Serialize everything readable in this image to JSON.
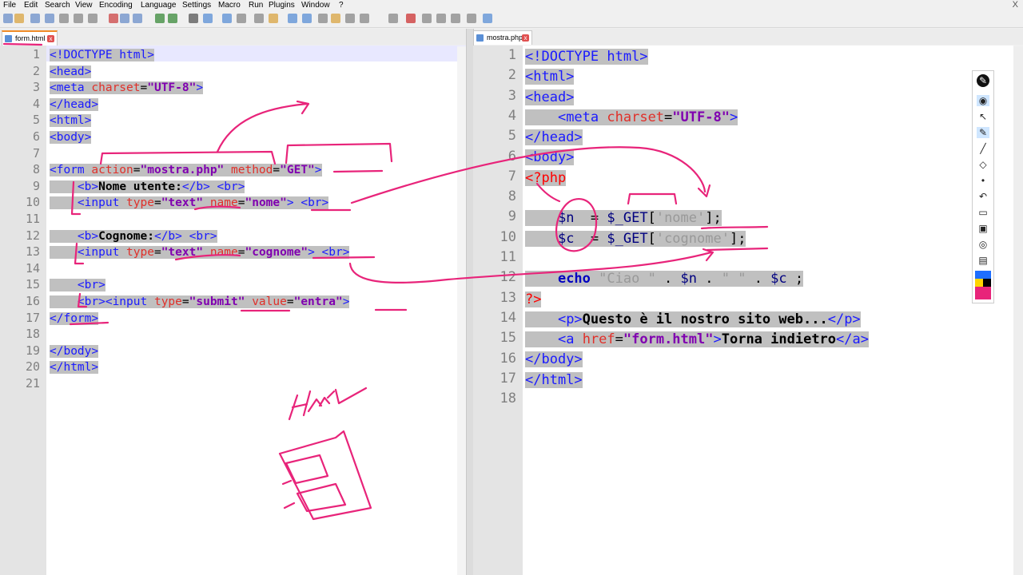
{
  "menu": {
    "items": [
      "File",
      "Edit",
      "Search",
      "View",
      "Encoding",
      "Language",
      "Settings",
      "Macro",
      "Run",
      "Plugins",
      "Window",
      "?"
    ],
    "close": "X"
  },
  "tabs": {
    "left": {
      "label": "form.html",
      "close": "x"
    },
    "right": {
      "label": "mostra.php",
      "close": "x"
    }
  },
  "left": {
    "line_numbers": [
      "1",
      "2",
      "3",
      "4",
      "5",
      "6",
      "7",
      "8",
      "9",
      "10",
      "11",
      "12",
      "13",
      "14",
      "15",
      "16",
      "17",
      "18",
      "19",
      "20",
      "21"
    ]
  },
  "right": {
    "line_numbers": [
      "1",
      "2",
      "3",
      "4",
      "5",
      "6",
      "7",
      "8",
      "9",
      "10",
      "11",
      "12",
      "13",
      "14",
      "15",
      "16",
      "17",
      "18"
    ]
  },
  "colors": {
    "accent_pen": "#e8247a",
    "selection": "#c0c0c0"
  },
  "handwriting": {
    "left_word": "Html"
  }
}
